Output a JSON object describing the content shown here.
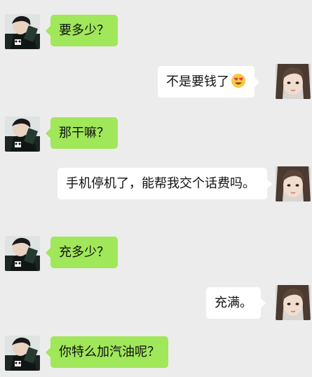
{
  "messages": [
    {
      "side": "left",
      "text": "要多少？"
    },
    {
      "side": "right",
      "text": "不是要钱了",
      "emoji": "heart-eyes-emoji"
    },
    {
      "side": "left",
      "text": "那干嘛？"
    },
    {
      "side": "right",
      "text": "手机停机了，能帮我交个话费吗。"
    },
    {
      "side": "left",
      "text": "充多少？"
    },
    {
      "side": "right",
      "text": "充满。"
    },
    {
      "side": "left",
      "text": "你特么加汽油呢？"
    }
  ],
  "colors": {
    "background": "#ececec",
    "left_bubble": "#a0e75a",
    "right_bubble": "#ffffff"
  }
}
